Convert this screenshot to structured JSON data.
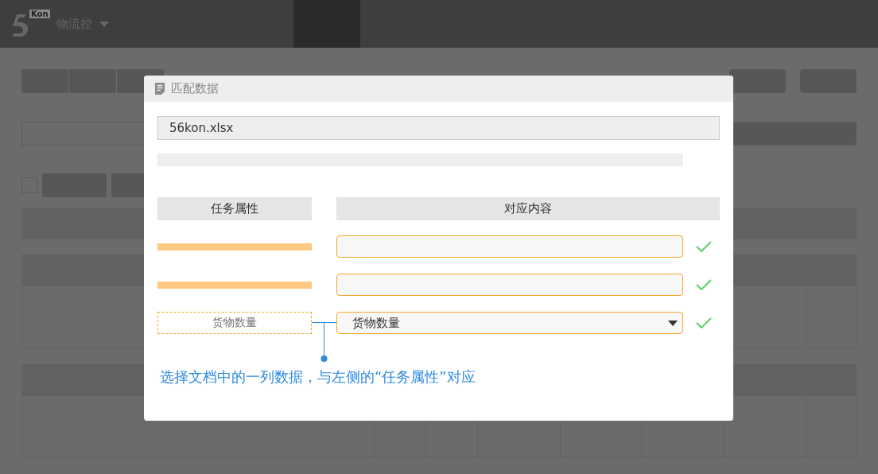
{
  "header": {
    "logo_badge": "Kon",
    "app_menu": "物流控"
  },
  "dialog": {
    "title": "匹配数据",
    "file_name": "56kon.xlsx",
    "columns": [
      "任务属性",
      "对应内容"
    ],
    "mappings": [
      {
        "kind": "blank",
        "matched": true
      },
      {
        "kind": "blank",
        "matched": true
      },
      {
        "kind": "dropdown",
        "attribute": "货物数量",
        "value": "货物数量",
        "matched": true
      }
    ],
    "annotation": "选择文档中的一列数据，与左侧的“任务属性”对应"
  }
}
